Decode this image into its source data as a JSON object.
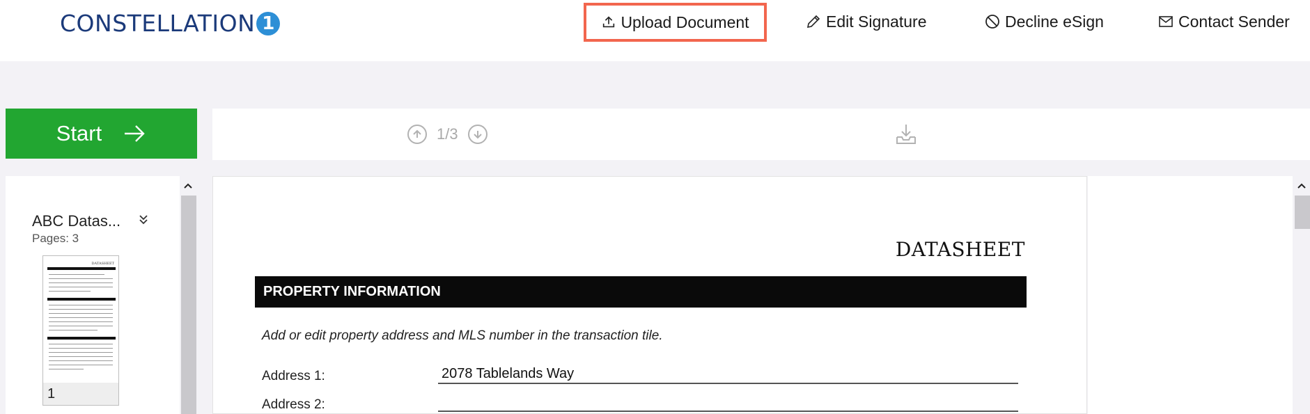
{
  "brand": {
    "name": "CONSTELLATION",
    "badge": "1"
  },
  "nav": {
    "upload": "Upload Document",
    "edit": "Edit Signature",
    "decline": "Decline eSign",
    "contact": "Contact Sender"
  },
  "start": {
    "label": "Start"
  },
  "toolbar": {
    "page_indicator": "1/3"
  },
  "sidebar": {
    "doc_name": "ABC Datas...",
    "pages": "Pages: 3",
    "thumb_page": "1",
    "thumb_title": "DATASHEET"
  },
  "document": {
    "title": "DATASHEET",
    "section": "PROPERTY INFORMATION",
    "note": "Add or edit property address and MLS number in the transaction tile.",
    "address1_label": "Address 1:",
    "address1_value": "2078 Tablelands Way",
    "address2_label": "Address 2:"
  },
  "colors": {
    "accent_start": "#22a631",
    "highlight": "#f2664e",
    "brand": "#1b3a7a"
  }
}
